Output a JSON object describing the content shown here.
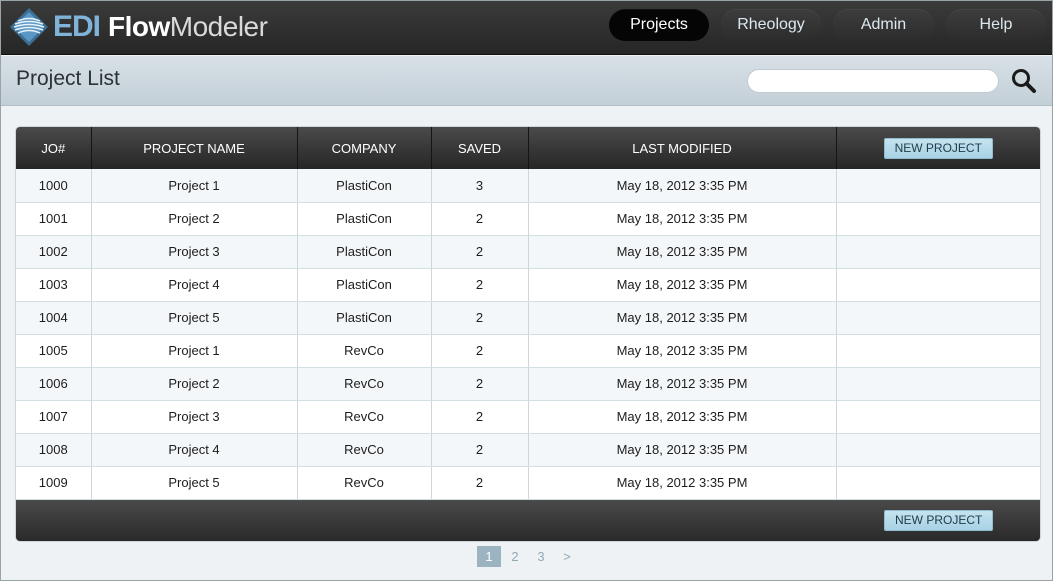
{
  "app": {
    "logo_edi": "EDI",
    "logo_flow": "Flow",
    "logo_modeler": "Modeler"
  },
  "nav": [
    {
      "label": "Projects",
      "active": true
    },
    {
      "label": "Rheology",
      "active": false
    },
    {
      "label": "Admin",
      "active": false
    },
    {
      "label": "Help",
      "active": false
    }
  ],
  "page": {
    "title": "Project List",
    "search_value": ""
  },
  "table": {
    "columns": [
      "JO#",
      "PROJECT NAME",
      "COMPANY",
      "SAVED",
      "LAST MODIFIED"
    ],
    "new_project_label": "NEW PROJECT",
    "rows": [
      {
        "jo": "1000",
        "name": "Project 1",
        "company": "PlastiCon",
        "saved": "3",
        "modified": "May 18, 2012 3:35 PM"
      },
      {
        "jo": "1001",
        "name": "Project 2",
        "company": "PlastiCon",
        "saved": "2",
        "modified": "May 18, 2012 3:35 PM"
      },
      {
        "jo": "1002",
        "name": "Project 3",
        "company": "PlastiCon",
        "saved": "2",
        "modified": "May 18, 2012 3:35 PM"
      },
      {
        "jo": "1003",
        "name": "Project 4",
        "company": "PlastiCon",
        "saved": "2",
        "modified": "May 18, 2012 3:35 PM"
      },
      {
        "jo": "1004",
        "name": "Project 5",
        "company": "PlastiCon",
        "saved": "2",
        "modified": "May 18, 2012 3:35 PM"
      },
      {
        "jo": "1005",
        "name": "Project 1",
        "company": "RevCo",
        "saved": "2",
        "modified": "May 18, 2012 3:35 PM"
      },
      {
        "jo": "1006",
        "name": "Project 2",
        "company": "RevCo",
        "saved": "2",
        "modified": "May 18, 2012 3:35 PM"
      },
      {
        "jo": "1007",
        "name": "Project 3",
        "company": "RevCo",
        "saved": "2",
        "modified": "May 18, 2012 3:35 PM"
      },
      {
        "jo": "1008",
        "name": "Project 4",
        "company": "RevCo",
        "saved": "2",
        "modified": "May 18, 2012 3:35 PM"
      },
      {
        "jo": "1009",
        "name": "Project 5",
        "company": "RevCo",
        "saved": "2",
        "modified": "May 18, 2012 3:35 PM"
      }
    ]
  },
  "footer": {
    "new_project_label": "NEW PROJECT"
  },
  "pagination": {
    "pages": [
      "1",
      "2",
      "3"
    ],
    "current": "1",
    "next_label": ">"
  },
  "icons": {
    "logo": "diamond-logo-icon",
    "search": "search-icon"
  },
  "colors": {
    "accent": "#7fb4d8",
    "button": "#a8d2e4",
    "topbar": "#2e2e2e"
  }
}
